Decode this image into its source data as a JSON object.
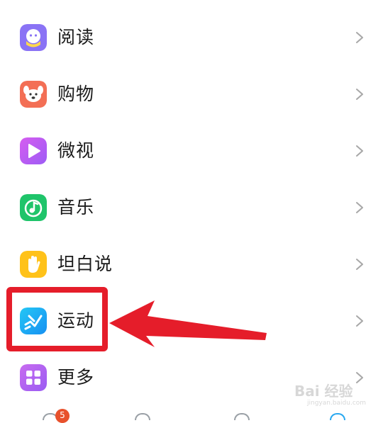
{
  "menu": {
    "items": [
      {
        "label": "阅读",
        "icon": "reading-mascot-icon",
        "color": "#8a73f5"
      },
      {
        "label": "购物",
        "icon": "shopping-dog-icon",
        "color": "#f36f55"
      },
      {
        "label": "微视",
        "icon": "weishi-play-icon",
        "color": "#c45ff0"
      },
      {
        "label": "音乐",
        "icon": "music-note-icon",
        "color": "#1fc46a"
      },
      {
        "label": "坦白说",
        "icon": "hand-icon",
        "color": "#ffc21a"
      },
      {
        "label": "运动",
        "icon": "running-icon",
        "color": "#1aa9f4"
      },
      {
        "label": "更多",
        "icon": "grid-more-icon",
        "color": "#b266f0"
      }
    ],
    "chevron_icon": "chevron-right-icon"
  },
  "annotation": {
    "highlight_color": "#e51d2a",
    "highlighted_item": "运动"
  },
  "bottom_bar": {
    "badge": "5"
  },
  "watermark": {
    "main": "Bai 经验",
    "sub": "jingyan.baidu.com"
  }
}
